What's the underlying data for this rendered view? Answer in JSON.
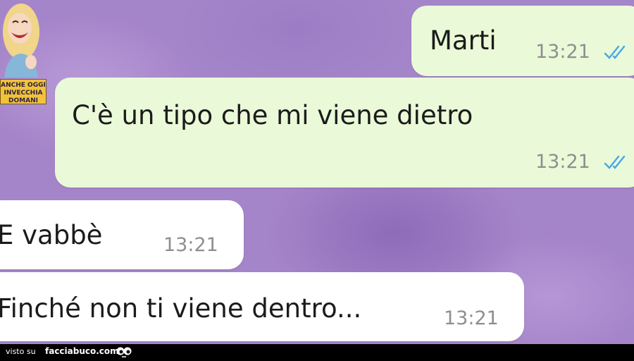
{
  "messages": [
    {
      "text": "Marti",
      "time": "13:21",
      "direction": "outgoing",
      "status": "read"
    },
    {
      "text": "C'è un tipo che mi viene dietro",
      "time": "13:21",
      "direction": "outgoing",
      "status": "read"
    },
    {
      "text": "E vabbè",
      "time": "13:21",
      "direction": "incoming"
    },
    {
      "text": "Finché non ti viene dentro...",
      "time": "13:21",
      "direction": "incoming"
    }
  ],
  "sticker": {
    "caption": "ANCHE OGGI INVECCHIA DOMANI",
    "icon": "laughing-woman-sticker"
  },
  "footer": {
    "prefix": "visto su",
    "site": "facciabuco.com",
    "icon": "eyes-icon"
  },
  "colors": {
    "background": "#a585c9",
    "outgoing_bubble": "#eafad8",
    "incoming_bubble": "#ffffff",
    "read_ticks": "#4aa8e8",
    "timestamp": "#8e8e8e"
  }
}
